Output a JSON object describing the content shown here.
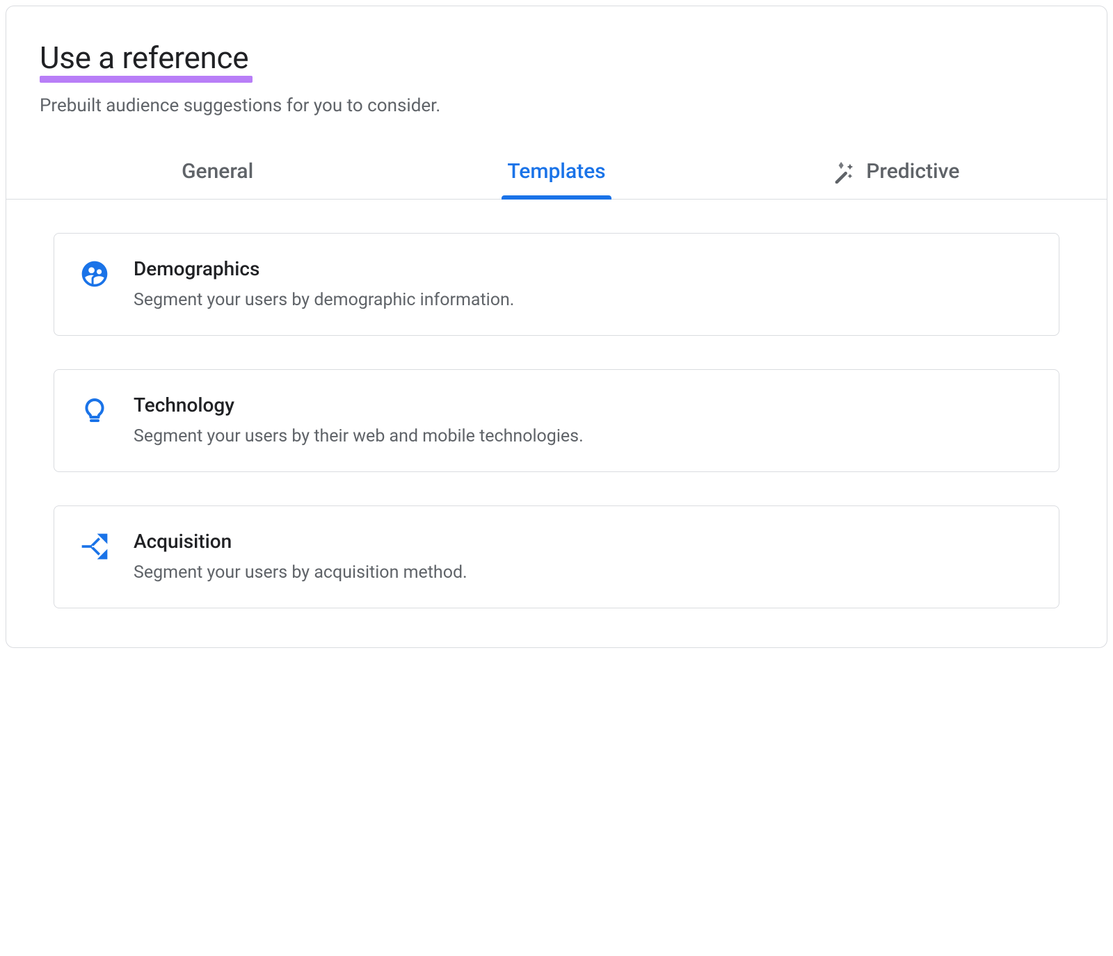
{
  "header": {
    "title": "Use a reference",
    "subtitle": "Prebuilt audience suggestions for you to consider."
  },
  "tabs": {
    "general": {
      "label": "General"
    },
    "templates": {
      "label": "Templates",
      "active": true
    },
    "predictive": {
      "label": "Predictive",
      "icon": "magic-wand"
    }
  },
  "templates": [
    {
      "icon": "supervised-user-circle",
      "title": "Demographics",
      "description": "Segment your users by demographic information."
    },
    {
      "icon": "lightbulb",
      "title": "Technology",
      "description": "Segment your users by their web and mobile technologies."
    },
    {
      "icon": "fork-arrows",
      "title": "Acquisition",
      "description": "Segment your users by acquisition method."
    }
  ],
  "colors": {
    "accent": "#1a73e8",
    "highlight": "#b87ef7",
    "textPrimary": "#202124",
    "textSecondary": "#5f6368",
    "border": "#dadce0"
  }
}
